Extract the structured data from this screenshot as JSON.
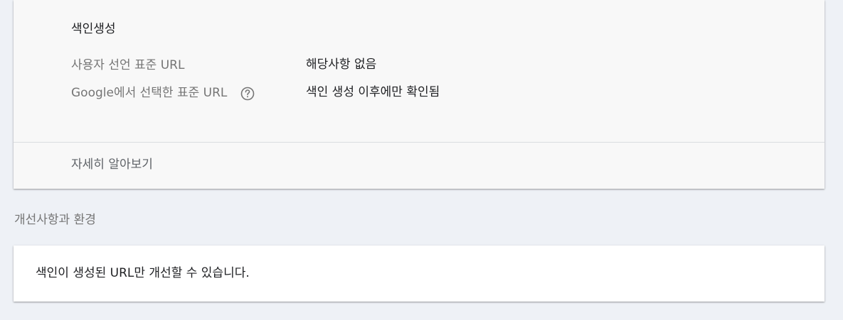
{
  "indexing": {
    "heading": "색인생성",
    "rows": [
      {
        "label": "사용자 선언 표준 URL",
        "value": "해당사항 없음"
      },
      {
        "label": "Google에서 선택한 표준 URL",
        "value": "색인 생성 이후에만 확인됨"
      }
    ],
    "help_icon": "help-circle-icon",
    "learn_more": "자세히 알아보기"
  },
  "enhancements": {
    "title": "개선사항과 환경",
    "message": "색인이 생성된 URL만 개선할 수 있습니다."
  },
  "colors": {
    "background": "#eef1f6",
    "card_top": "#f8f8f8",
    "card_bottom": "#ffffff",
    "label_text": "#757575",
    "primary_text": "#202124"
  }
}
